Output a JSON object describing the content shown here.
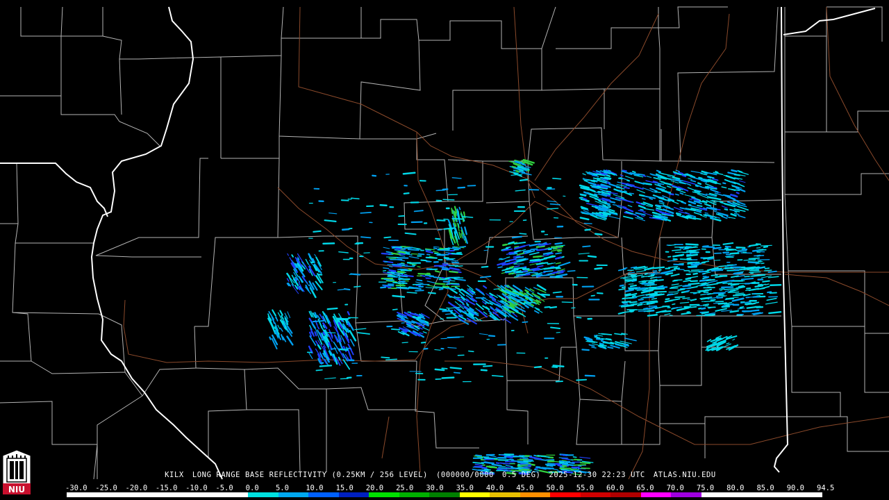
{
  "product": {
    "station": "KILX",
    "description": "LONG RANGE BASE REFLECTIVITY (0.25KM / 256 LEVEL)",
    "volume": "(000000/0000",
    "elevation": "0.5 DEG)",
    "datetime": "2025-12-30 22:23 UTC",
    "source": "ATLAS.NIU.EDU"
  },
  "logo": {
    "text": "NIU",
    "icon": "niu-tower-logo-icon",
    "color": "#c8102e"
  },
  "colorscale": {
    "labels": [
      "-30.0",
      "-25.0",
      "-20.0",
      "-15.0",
      "-10.0",
      "-5.0",
      "0.0",
      "5.0",
      "10.0",
      "15.0",
      "20.0",
      "25.0",
      "30.0",
      "35.0",
      "40.0",
      "45.0",
      "50.0",
      "55.0",
      "60.0",
      "65.0",
      "70.0",
      "75.0",
      "80.0",
      "85.0",
      "90.0",
      "94.5"
    ],
    "colors": [
      "#ffffff",
      "#ffffff",
      "#ffffff",
      "#ffffff",
      "#ffffff",
      "#ffffff",
      "#00e0e0",
      "#00a8f0",
      "#0060ff",
      "#0020c0",
      "#00e000",
      "#00b000",
      "#008000",
      "#ffff00",
      "#e8c000",
      "#ff9000",
      "#ff0000",
      "#d00000",
      "#b00000",
      "#ff00ff",
      "#a000e0",
      "#ffffff",
      "#ffffff",
      "#ffffff",
      "#ffffff"
    ]
  },
  "map_colors": {
    "background": "#000000",
    "county_lines": "#b4b4b4",
    "state_lines": "#ffffff",
    "highways": "#8b4a2b",
    "echo_light": "#00d8e8",
    "echo_mid": "#00a0f0",
    "echo_heavy": "#2040ff",
    "echo_green": "#30d040"
  }
}
